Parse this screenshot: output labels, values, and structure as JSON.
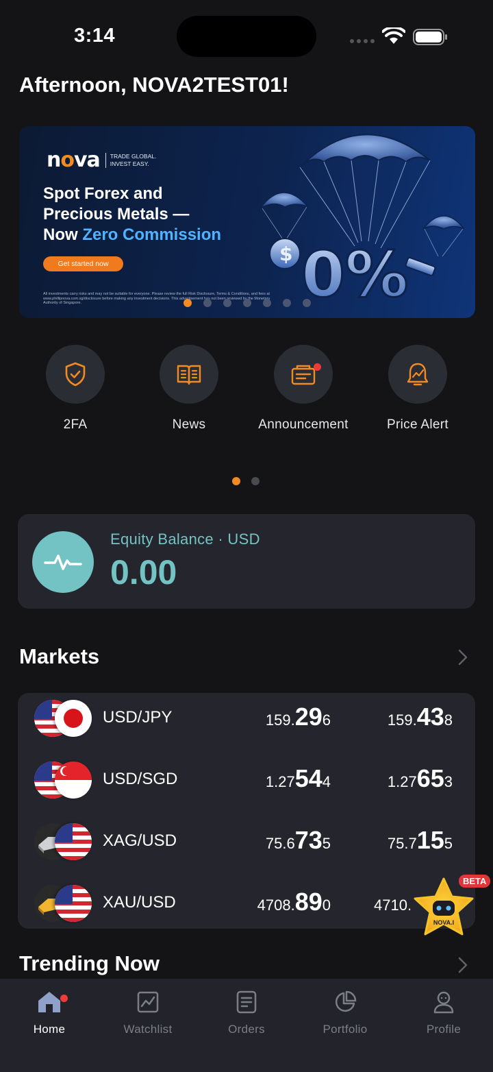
{
  "status_bar": {
    "time": "3:14"
  },
  "greeting": "Afternoon, NOVA2TEST01!",
  "banner": {
    "logo_text": "nova",
    "logo_tagline_1": "TRADE GLOBAL.",
    "logo_tagline_2": "INVEST EASY.",
    "headline_1": "Spot Forex and",
    "headline_2": "Precious Metals —",
    "headline_3_prefix": "Now ",
    "headline_3_highlight": "Zero Commission",
    "cta_label": "Get started now",
    "art_text": "0%",
    "disclaimer": "All investments carry risks and may not be suitable for everyone. Please review the full Risk Disclosure, Terms & Conditions, and fees at www.phillipnova.com.sg/disclosure before making any investment decisions. This advertisement has not been reviewed by the Monetary Authority of Singapore.",
    "slide_count": 7,
    "active_slide": 0
  },
  "quick_actions": [
    {
      "label": "2FA",
      "icon": "shield-check-icon"
    },
    {
      "label": "News",
      "icon": "book-icon"
    },
    {
      "label": "Announcement",
      "icon": "announcement-icon"
    },
    {
      "label": "Price Alert",
      "icon": "bell-chart-icon"
    }
  ],
  "quick_pages": {
    "count": 2,
    "active": 0
  },
  "equity": {
    "label": "Equity Balance · USD",
    "value": "0.00",
    "icon": "pulse-icon"
  },
  "markets": {
    "title": "Markets",
    "rows": [
      {
        "pair": "USD/JPY",
        "bid_pre": "159.",
        "bid_big": "29",
        "bid_post": "6",
        "ask_pre": "159.",
        "ask_big": "43",
        "ask_post": "8",
        "flags": [
          "us-flag",
          "japan-flag"
        ]
      },
      {
        "pair": "USD/SGD",
        "bid_pre": "1.27",
        "bid_big": "54",
        "bid_post": "4",
        "ask_pre": "1.27",
        "ask_big": "65",
        "ask_post": "3",
        "flags": [
          "us-flag",
          "singapore-flag"
        ]
      },
      {
        "pair": "XAG/USD",
        "bid_pre": "75.6",
        "bid_big": "73",
        "bid_post": "5",
        "ask_pre": "75.7",
        "ask_big": "15",
        "ask_post": "5",
        "flags": [
          "silver-bar-icon",
          "us-flag"
        ]
      },
      {
        "pair": "XAU/USD",
        "bid_pre": "4708.",
        "bid_big": "89",
        "bid_post": "0",
        "ask_pre": "4710.",
        "ask_big": "",
        "ask_post": "",
        "flags": [
          "gold-bar-icon",
          "us-flag"
        ]
      }
    ]
  },
  "trending": {
    "title": "Trending Now"
  },
  "assistant": {
    "badge": "BETA",
    "label": "NOVA.I"
  },
  "tabbar": [
    {
      "label": "Home",
      "icon": "home-icon",
      "active": true
    },
    {
      "label": "Watchlist",
      "icon": "watchlist-icon",
      "active": false
    },
    {
      "label": "Orders",
      "icon": "orders-icon",
      "active": false
    },
    {
      "label": "Portfolio",
      "icon": "portfolio-icon",
      "active": false
    },
    {
      "label": "Profile",
      "icon": "profile-icon",
      "active": false
    }
  ],
  "colors": {
    "accent": "#f28b22",
    "teal": "#74c3c4",
    "background": "#141416",
    "card": "#25262d",
    "notification": "#ee3b38"
  }
}
